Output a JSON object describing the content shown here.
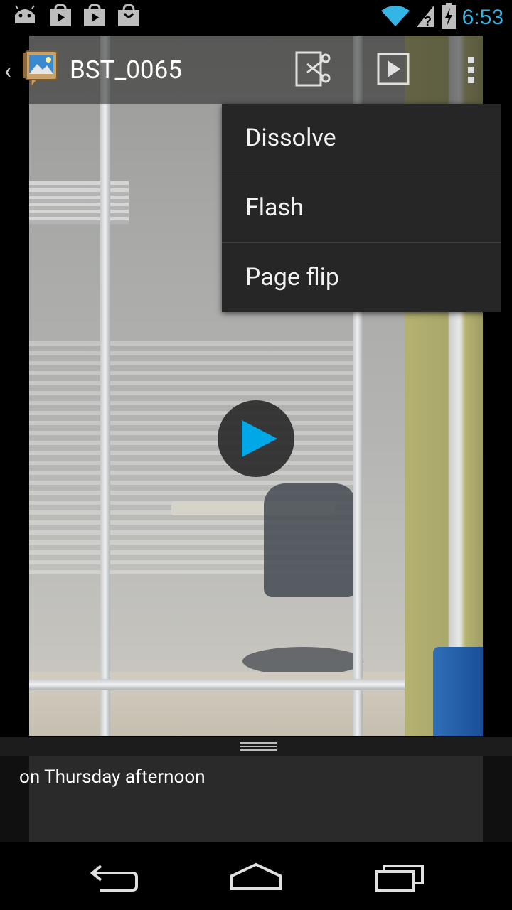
{
  "status_bar": {
    "time": "6:53",
    "notification_icons": [
      "android-icon",
      "play-store-icon",
      "play-store-icon",
      "shopping-bag-icon"
    ],
    "system_icons": [
      "wifi-icon",
      "no-sim-icon",
      "battery-charging-icon"
    ],
    "accent_color": "#33b5e5"
  },
  "action_bar": {
    "title": "BST_0065",
    "actions": [
      "trim-icon",
      "play-icon",
      "overflow-icon"
    ]
  },
  "menu": {
    "items": [
      {
        "label": "Dissolve"
      },
      {
        "label": "Flash"
      },
      {
        "label": "Page flip"
      }
    ]
  },
  "caption": {
    "text": "on Thursday afternoon"
  },
  "nav_bar": {
    "buttons": [
      "back-icon",
      "home-icon",
      "recents-icon"
    ]
  },
  "colors": {
    "play_blue": "#00a8e8",
    "menu_bg": "#262626"
  }
}
